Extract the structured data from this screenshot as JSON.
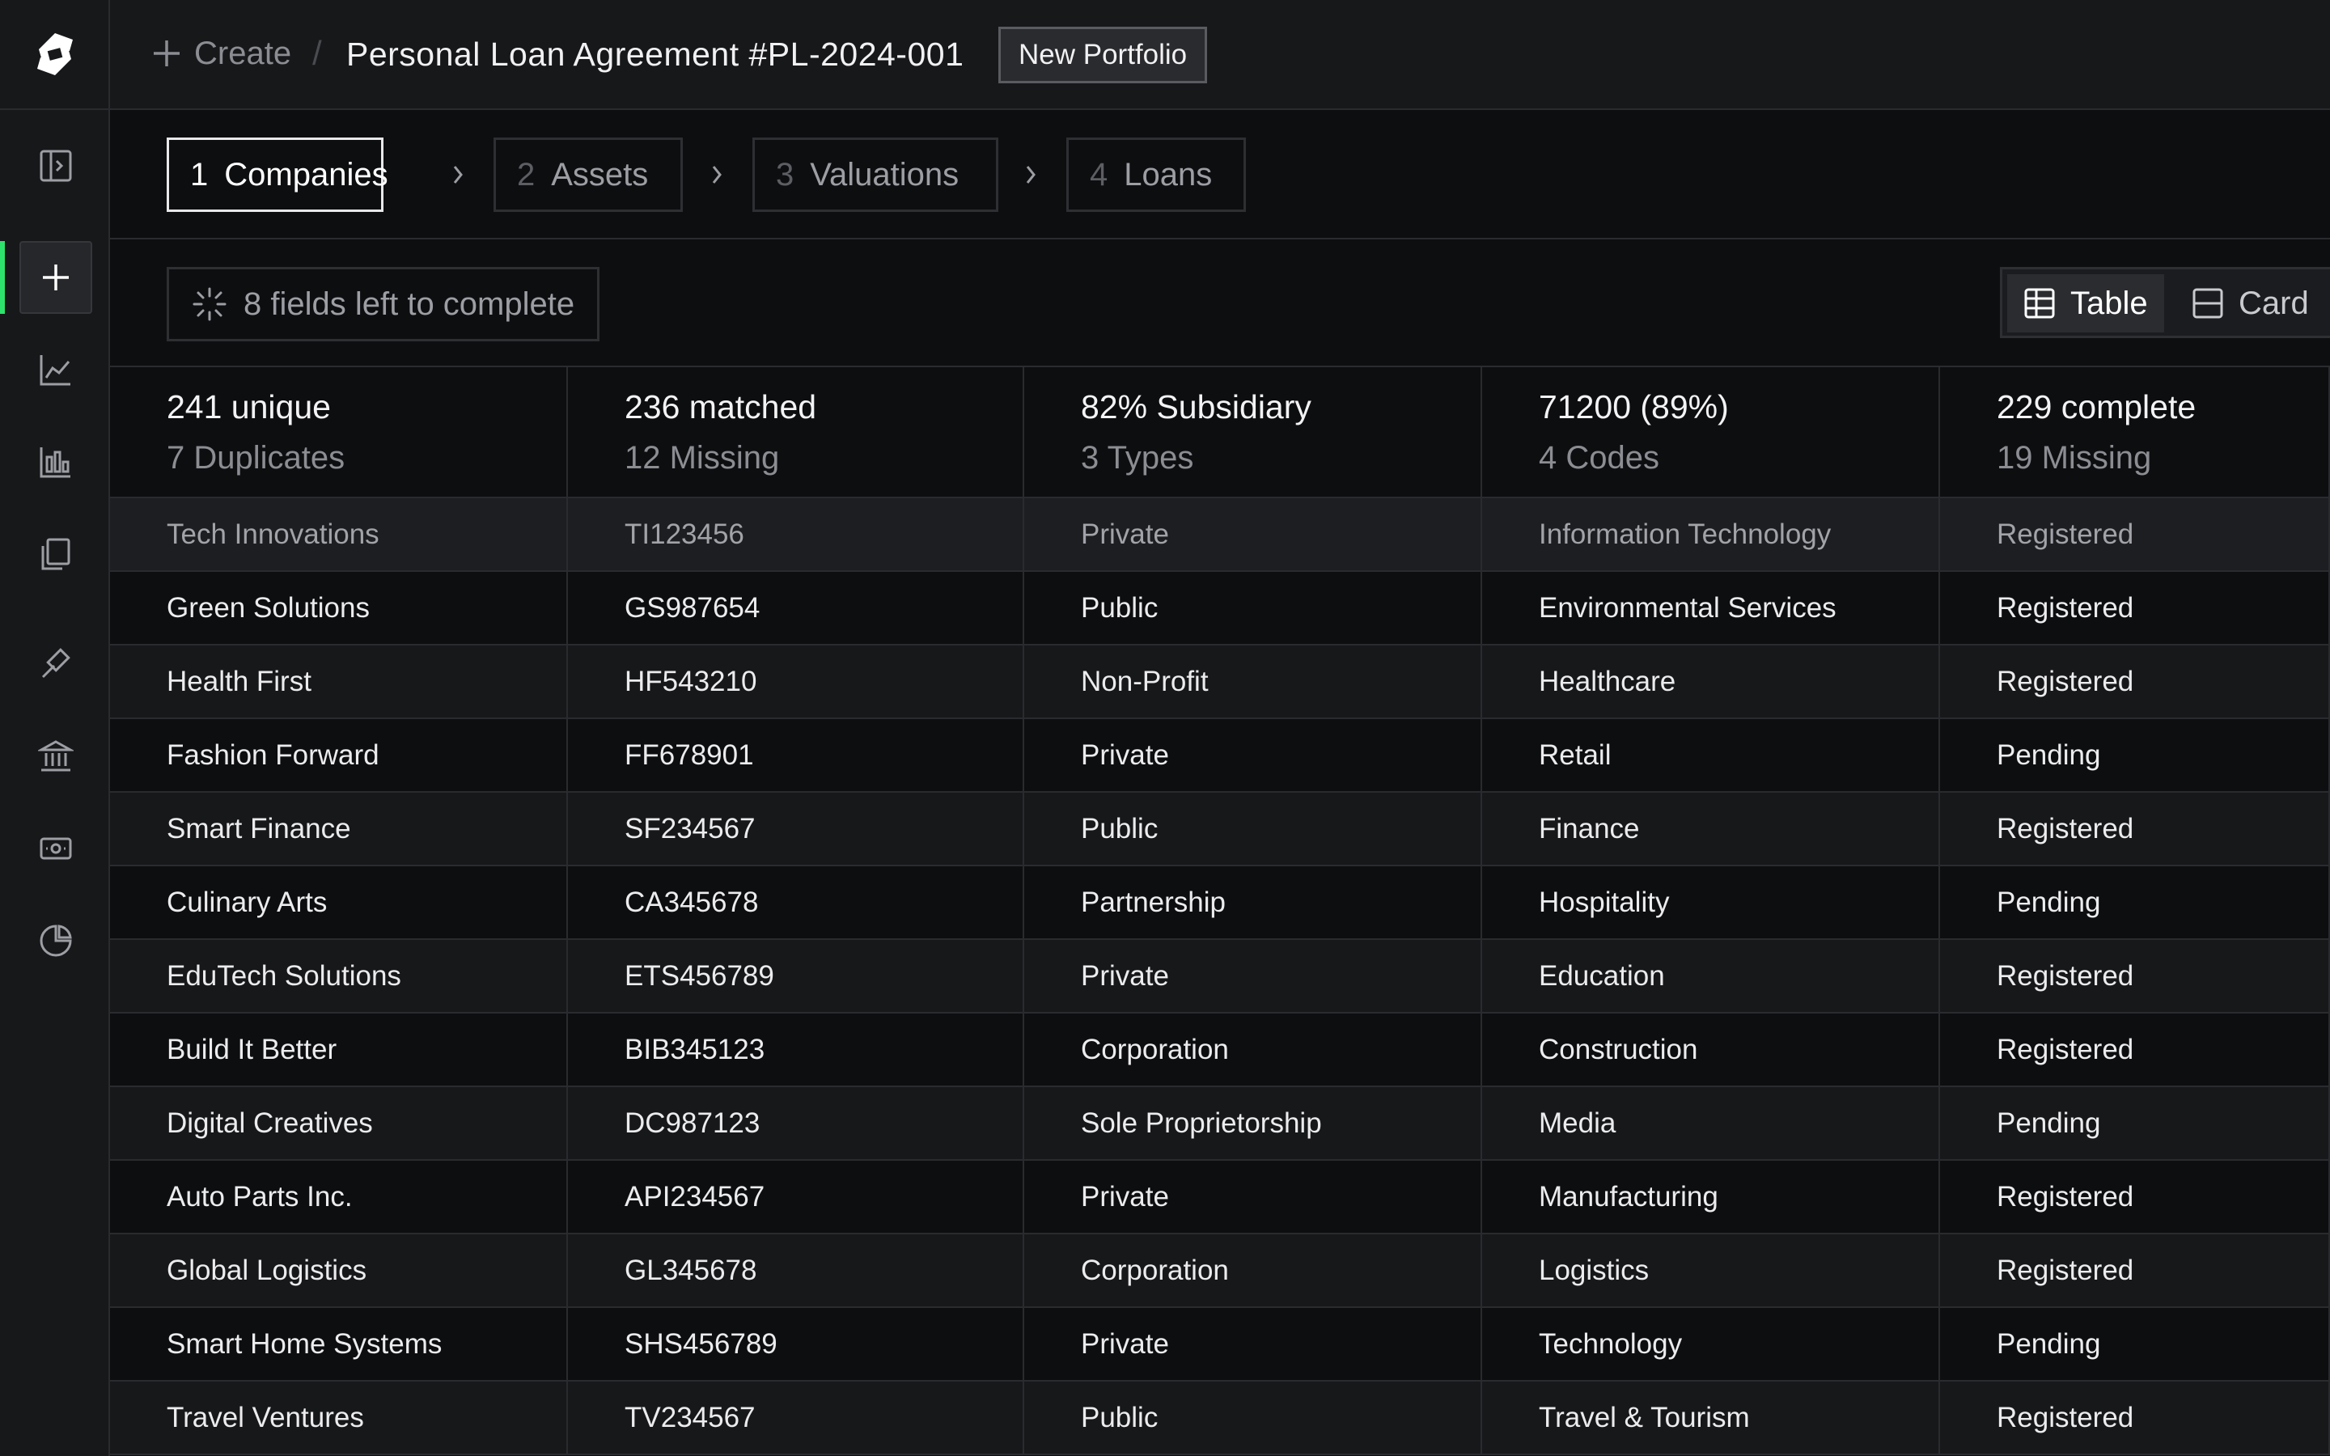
{
  "header": {
    "create_label": "Create",
    "separator": "/",
    "document_title": "Personal Loan Agreement #PL-2024-001",
    "portfolio_badge": "New Portfolio"
  },
  "sidebar": {
    "items": [
      {
        "icon": "panel-toggle-icon"
      },
      {
        "icon": "plus-icon",
        "active": true
      },
      {
        "icon": "line-chart-icon"
      },
      {
        "icon": "bar-chart-icon"
      },
      {
        "icon": "documents-icon"
      },
      {
        "icon": "gavel-icon"
      },
      {
        "icon": "bank-icon"
      },
      {
        "icon": "cash-icon"
      },
      {
        "icon": "pie-chart-icon"
      }
    ],
    "accent_color": "#2ee36b"
  },
  "steps": [
    {
      "num": "1",
      "label": "Companies",
      "active": true
    },
    {
      "num": "2",
      "label": "Assets"
    },
    {
      "num": "3",
      "label": "Valuations"
    },
    {
      "num": "4",
      "label": "Loans"
    }
  ],
  "toolbar": {
    "fields_left": "8 fields left to complete",
    "view_table": "Table",
    "view_card": "Card"
  },
  "summary": [
    {
      "main": "241 unique",
      "sub": "7 Duplicates"
    },
    {
      "main": "236 matched",
      "sub": "12 Missing"
    },
    {
      "main": "82% Subsidiary",
      "sub": "3 Types"
    },
    {
      "main": "71200 (89%)",
      "sub": "4 Codes"
    },
    {
      "main": "229 complete",
      "sub": "19 Missing"
    }
  ],
  "rows": [
    [
      "Tech Innovations",
      "TI123456",
      "Private",
      "Information Technology",
      "Registered"
    ],
    [
      "Green Solutions",
      "GS987654",
      "Public",
      "Environmental Services",
      "Registered"
    ],
    [
      "Health First",
      "HF543210",
      "Non-Profit",
      "Healthcare",
      "Registered"
    ],
    [
      "Fashion Forward",
      "FF678901",
      "Private",
      "Retail",
      "Pending"
    ],
    [
      "Smart Finance",
      "SF234567",
      "Public",
      "Finance",
      "Registered"
    ],
    [
      "Culinary Arts",
      "CA345678",
      "Partnership",
      "Hospitality",
      "Pending"
    ],
    [
      "EduTech Solutions",
      "ETS456789",
      "Private",
      "Education",
      "Registered"
    ],
    [
      "Build It Better",
      "BIB345123",
      "Corporation",
      "Construction",
      "Registered"
    ],
    [
      "Digital Creatives",
      "DC987123",
      "Sole Proprietorship",
      "Media",
      "Pending"
    ],
    [
      "Auto Parts Inc.",
      "API234567",
      "Private",
      "Manufacturing",
      "Registered"
    ],
    [
      "Global Logistics",
      "GL345678",
      "Corporation",
      "Logistics",
      "Registered"
    ],
    [
      "Smart Home Systems",
      "SHS456789",
      "Private",
      "Technology",
      "Pending"
    ],
    [
      "Travel Ventures",
      "TV234567",
      "Public",
      "Travel & Tourism",
      "Registered"
    ]
  ]
}
